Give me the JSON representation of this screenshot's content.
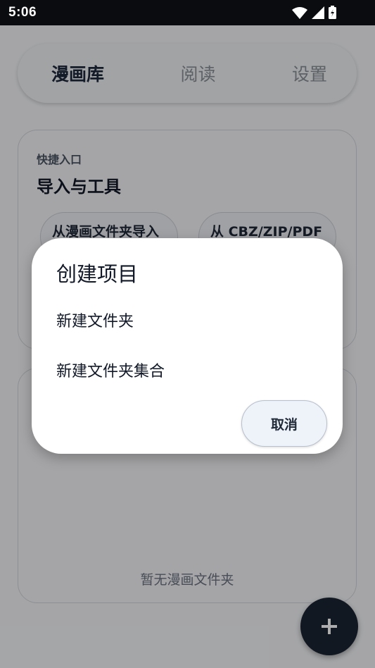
{
  "status_bar": {
    "time": "5:06",
    "icons": [
      "wifi-icon",
      "cellular-signal-icon",
      "battery-charging-icon"
    ]
  },
  "tabs": [
    {
      "label": "漫画库",
      "active": true
    },
    {
      "label": "阅读",
      "active": false
    },
    {
      "label": "设置",
      "active": false
    }
  ],
  "quick_entry": {
    "kicker": "快捷入口",
    "title": "导入与工具",
    "buttons": [
      {
        "label": "从漫画文件夹导入"
      },
      {
        "label": "从 CBZ/ZIP/PDF"
      }
    ]
  },
  "library": {
    "empty_text": "暂无漫画文件夹"
  },
  "fab": {
    "icon": "plus-icon"
  },
  "dialog": {
    "title": "创建项目",
    "items": [
      {
        "label": "新建文件夹"
      },
      {
        "label": "新建文件夹集合"
      }
    ],
    "cancel_label": "取消"
  },
  "colors": {
    "background": "#f3f4f6",
    "status_bar": "#0b0c0f",
    "fab": "#1b2433",
    "dialog": "#ffffff",
    "cancel_button": "#eef2f9"
  }
}
